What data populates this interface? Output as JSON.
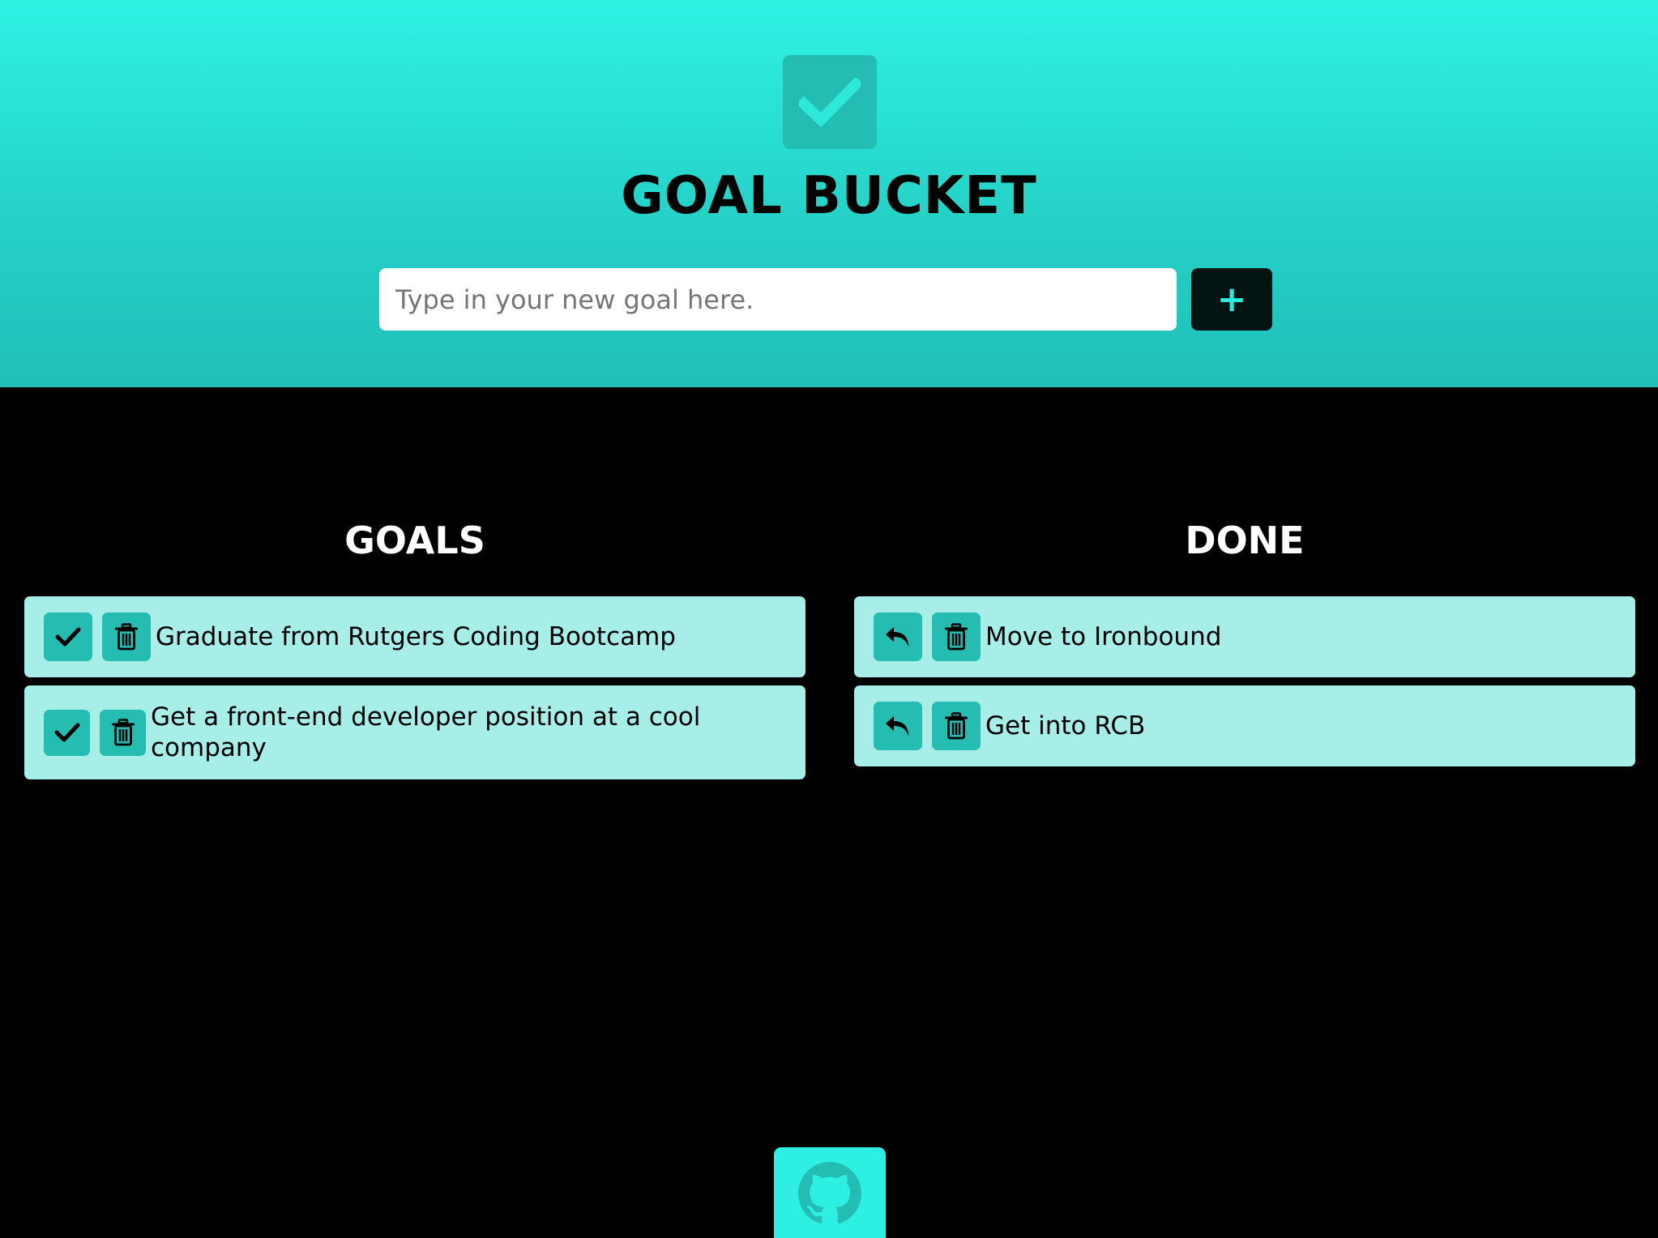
{
  "header": {
    "logo_icon": "checkbox-check-icon",
    "title": "GOAL BUCKET",
    "input_placeholder": "Type in your new goal here.",
    "input_value": "",
    "add_button_label": "+"
  },
  "goals": {
    "heading": "GOALS",
    "items": [
      {
        "text": "Graduate from Rutgers Coding Bootcamp",
        "actions": [
          "check-icon",
          "trash-icon"
        ]
      },
      {
        "text": "Get a front-end developer position at a cool company",
        "actions": [
          "check-icon",
          "trash-icon"
        ]
      }
    ]
  },
  "done": {
    "heading": "DONE",
    "items": [
      {
        "text": "Move to Ironbound",
        "actions": [
          "undo-icon",
          "trash-icon"
        ]
      },
      {
        "text": "Get into RCB",
        "actions": [
          "undo-icon",
          "trash-icon"
        ]
      }
    ]
  },
  "footer": {
    "github_icon": "github-icon"
  },
  "colors": {
    "accent": "#2ef2e3",
    "accent_dark": "#24bdb3",
    "card": "#a8eee8",
    "background": "#000000"
  }
}
